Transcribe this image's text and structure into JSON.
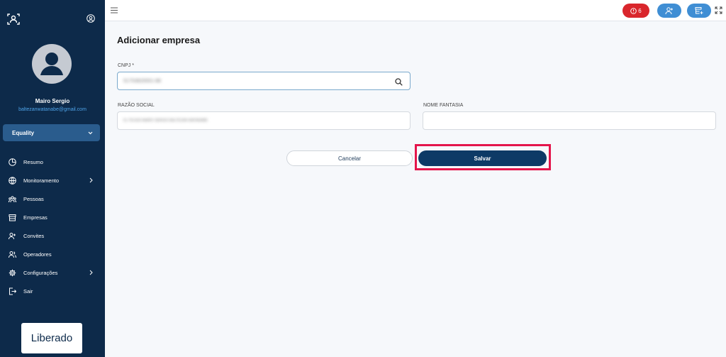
{
  "sidebar": {
    "user_name": "Mairo Sergio",
    "user_email": "baltezanwatanabe@gmail.com",
    "company": "Equality",
    "items": [
      {
        "label": "Resumo",
        "icon": "chart-pie-icon"
      },
      {
        "label": "Monitoramento",
        "icon": "globe-icon"
      },
      {
        "label": "Pessoas",
        "icon": "people-icon"
      },
      {
        "label": "Empresas",
        "icon": "store-icon"
      },
      {
        "label": "Convites",
        "icon": "user-plus-icon"
      },
      {
        "label": "Operadores",
        "icon": "users-icon"
      },
      {
        "label": "Configurações",
        "icon": "gear-icon"
      },
      {
        "label": "Sair",
        "icon": "logout-icon"
      }
    ],
    "logo_text": "Liberado"
  },
  "topbar": {
    "alert_count": "6"
  },
  "main": {
    "title": "Adicionar empresa",
    "cnpj_label": "CNPJ *",
    "cnpj_value": "51753820001-88",
    "razao_label": "RAZÃO SOCIAL",
    "razao_value": "51.753.820 MAIRO SERGIO BALTEZAN WATANABE",
    "fantasia_label": "NOME FANTASIA",
    "fantasia_value": "",
    "cancel_label": "Cancelar",
    "save_label": "Salvar"
  },
  "colors": {
    "sidebar_bg": "#0d2a4a",
    "accent": "#0d3a66",
    "alert": "#d9262c",
    "highlight": "#e4154b"
  }
}
